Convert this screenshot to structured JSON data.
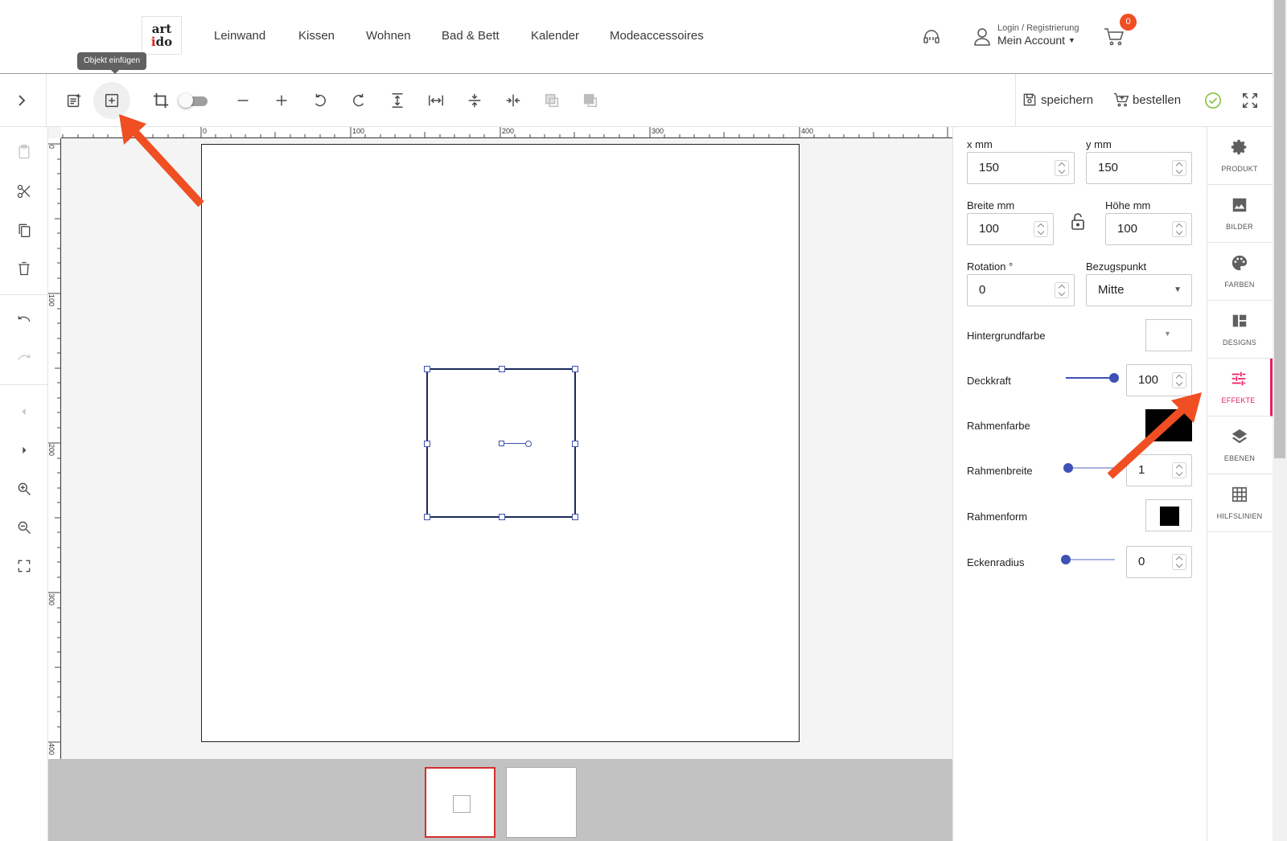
{
  "nav": {
    "logo_line1": "art",
    "logo_line2": "ido",
    "links": [
      "Leinwand",
      "Kissen",
      "Wohnen",
      "Bad & Bett",
      "Kalender",
      "Modeaccessoires"
    ],
    "account_small": "Login / Registrierung",
    "account_big": "Mein Account",
    "cart_count": "0"
  },
  "tooltip": "Objekt einfügen",
  "toolbar": {
    "save_label": "speichern",
    "order_label": "bestellen"
  },
  "ruler": {
    "top_labels": [
      "0",
      "100",
      "200",
      "300",
      "400"
    ],
    "left_labels": [
      "0",
      "100",
      "200",
      "300",
      "400"
    ]
  },
  "properties": {
    "x_label": "x mm",
    "x_value": "150",
    "y_label": "y mm",
    "y_value": "150",
    "width_label": "Breite mm",
    "width_value": "100",
    "height_label": "Höhe mm",
    "height_value": "100",
    "rotation_label": "Rotation °",
    "rotation_value": "0",
    "reference_label": "Bezugspunkt",
    "reference_value": "Mitte",
    "bgcolor_label": "Hintergrundfarbe",
    "opacity_label": "Deckkraft",
    "opacity_value": "100",
    "border_color_label": "Rahmenfarbe",
    "border_width_label": "Rahmenbreite",
    "border_width_value": "1",
    "border_shape_label": "Rahmenform",
    "corner_radius_label": "Eckenradius",
    "corner_radius_value": "0"
  },
  "tabs": [
    "PRODUKT",
    "BILDER",
    "FARBEN",
    "DESIGNS",
    "EFFEKTE",
    "EBENEN",
    "HILFSLINIEN"
  ],
  "colors": {
    "accent_pink": "#e91e63",
    "slider_blue": "#3f51b5",
    "cart_badge": "#f04e23",
    "annotation_arrow": "#f04e23",
    "check_green": "#8bc34a"
  }
}
